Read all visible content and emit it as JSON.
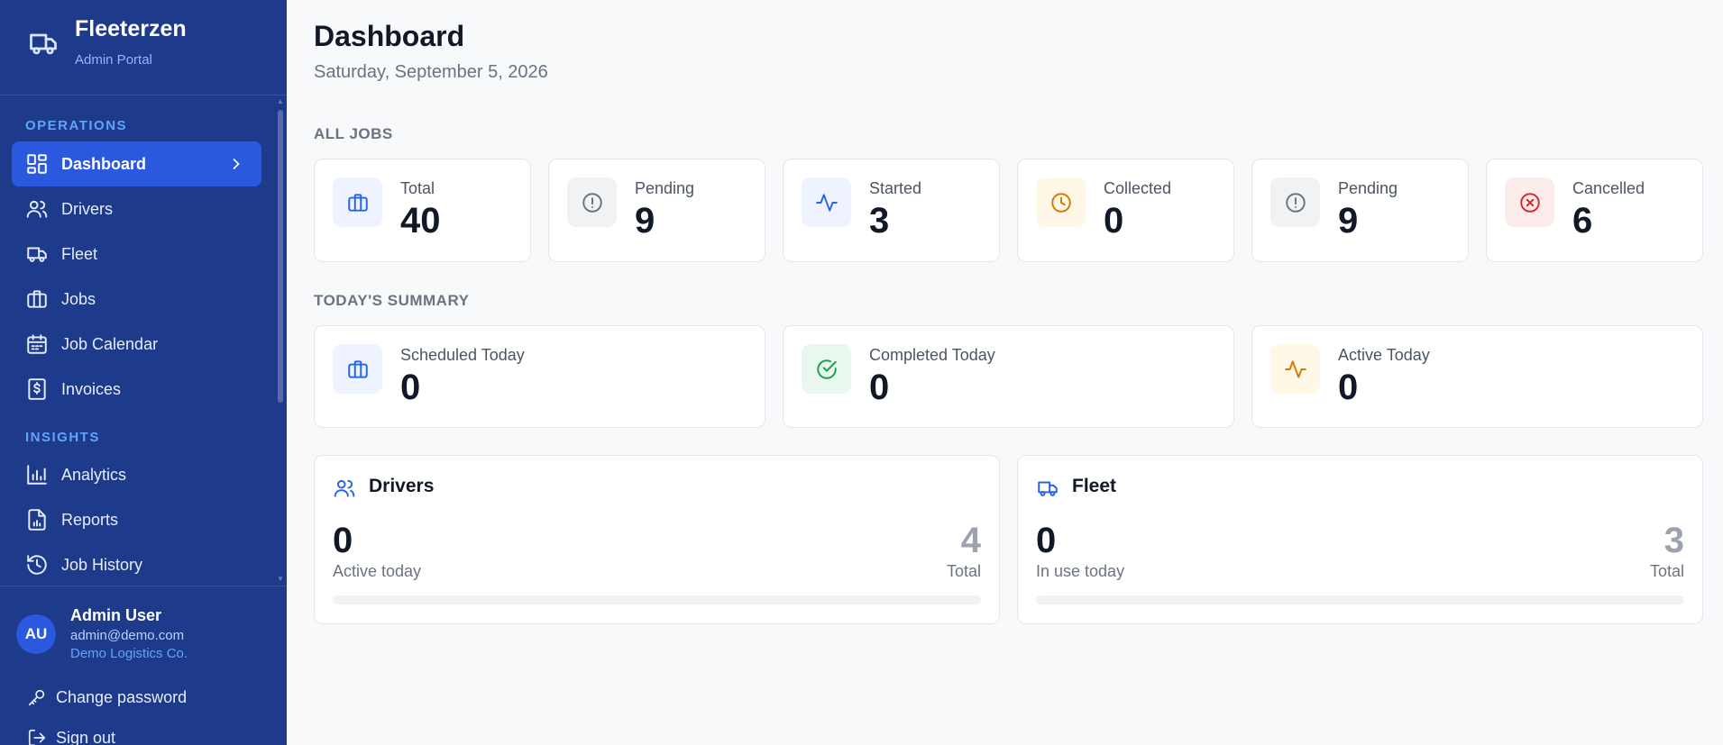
{
  "brand": {
    "name": "Fleeterzen",
    "subtitle": "Admin Portal",
    "icon": "truck-icon"
  },
  "nav": {
    "sections": [
      {
        "label": "OPERATIONS"
      },
      {
        "label": "INSIGHTS"
      }
    ],
    "items": [
      {
        "label": "Dashboard",
        "icon": "grid-icon",
        "active": true
      },
      {
        "label": "Drivers",
        "icon": "users-icon"
      },
      {
        "label": "Fleet",
        "icon": "truck-icon"
      },
      {
        "label": "Jobs",
        "icon": "briefcase-icon"
      },
      {
        "label": "Job Calendar",
        "icon": "calendar-icon"
      },
      {
        "label": "Invoices",
        "icon": "receipt-icon"
      },
      {
        "label": "Analytics",
        "icon": "bar-chart-icon"
      },
      {
        "label": "Reports",
        "icon": "file-chart-icon"
      },
      {
        "label": "Job History",
        "icon": "history-icon"
      }
    ]
  },
  "user": {
    "initials": "AU",
    "name": "Admin User",
    "email": "admin@demo.com",
    "org": "Demo Logistics Co.",
    "change_password": "Change password",
    "sign_out": "Sign out"
  },
  "header": {
    "title": "Dashboard",
    "date": "Saturday, September 5, 2026"
  },
  "all_jobs": {
    "title": "ALL JOBS",
    "stats": [
      {
        "label": "Total",
        "value": "40",
        "icon": "briefcase-icon",
        "tone": "blue"
      },
      {
        "label": "Pending",
        "value": "9",
        "icon": "alert-circle-icon",
        "tone": "gray"
      },
      {
        "label": "Started",
        "value": "3",
        "icon": "activity-icon",
        "tone": "blue"
      },
      {
        "label": "Collected",
        "value": "0",
        "icon": "clock-icon",
        "tone": "yellow"
      },
      {
        "label": "Pending",
        "value": "9",
        "icon": "alert-circle-icon",
        "tone": "gray"
      },
      {
        "label": "Cancelled",
        "value": "6",
        "icon": "x-circle-icon",
        "tone": "red"
      }
    ]
  },
  "today": {
    "title": "TODAY'S SUMMARY",
    "stats": [
      {
        "label": "Scheduled Today",
        "value": "0",
        "icon": "briefcase-icon",
        "tone": "blue"
      },
      {
        "label": "Completed Today",
        "value": "0",
        "icon": "check-circle-icon",
        "tone": "green"
      },
      {
        "label": "Active Today",
        "value": "0",
        "icon": "activity-icon",
        "tone": "yellow"
      }
    ]
  },
  "resources": {
    "drivers": {
      "title": "Drivers",
      "icon": "users-icon",
      "value": "0",
      "value_label": "Active today",
      "total": "4",
      "total_label": "Total",
      "fill": 0
    },
    "fleet": {
      "title": "Fleet",
      "icon": "truck-icon",
      "value": "0",
      "value_label": "In use today",
      "total": "3",
      "total_label": "Total",
      "fill": 0
    }
  },
  "colors": {
    "sidebar": "#1e3a8a",
    "active_nav": "#2a59e0",
    "accent": "#2563eb",
    "section_label": "#60a5fa"
  }
}
